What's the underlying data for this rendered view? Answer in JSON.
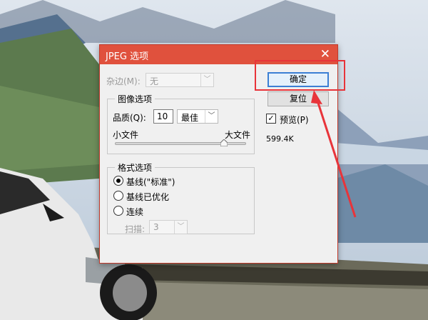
{
  "dialog": {
    "title": "JPEG 选项",
    "matte_label": "杂边(M):",
    "matte_value": "无",
    "image_options": {
      "group_label": "图像选项",
      "quality_label": "品质(Q):",
      "quality_value": "10",
      "quality_preset": "最佳",
      "small_file_label": "小文件",
      "large_file_label": "大文件",
      "slider_level_fraction": 0.83
    },
    "format_options": {
      "group_label": "格式选项",
      "options": [
        "基线(\"标准\")",
        "基线已优化",
        "连续"
      ],
      "selected_index": 0,
      "scans_label": "扫描:",
      "scans_value": "3"
    },
    "ok_label": "确定",
    "reset_label": "复位",
    "preview_label": "预览(P)",
    "preview_checked": true,
    "file_size": "599.4K"
  },
  "colors": {
    "titlebar": "#e0513d",
    "annotation": "#e8343a",
    "ok_border": "#3c7fd4"
  }
}
